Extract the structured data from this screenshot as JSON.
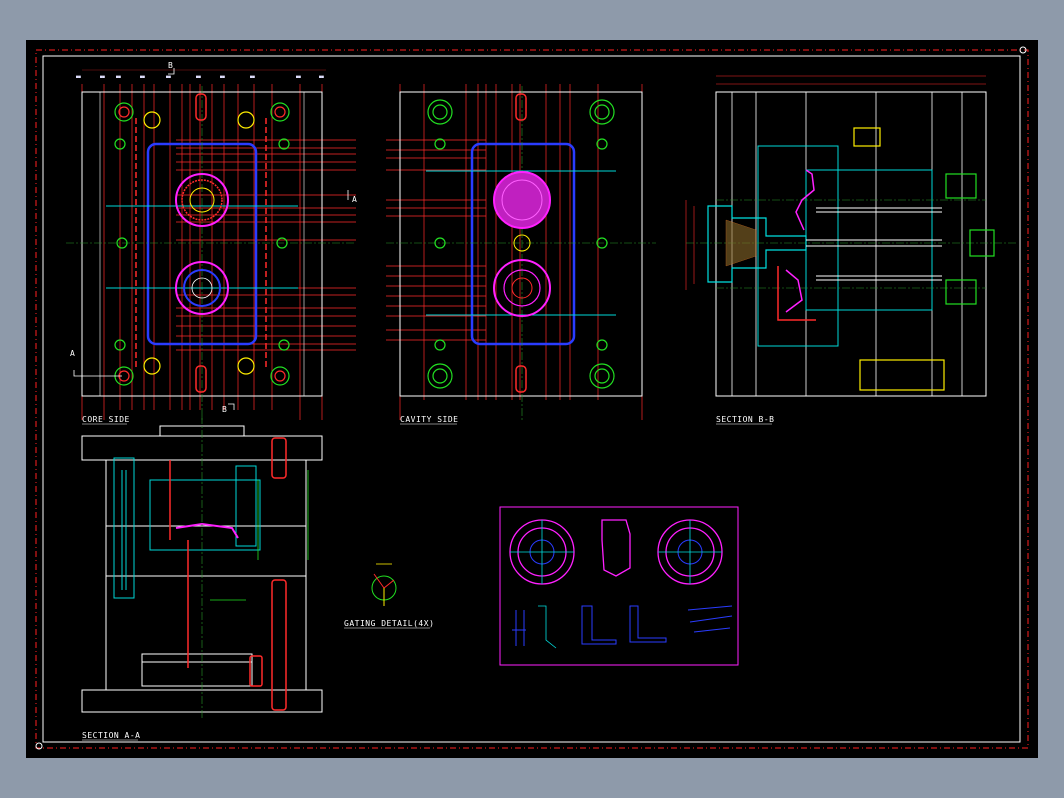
{
  "drawing": {
    "views": {
      "core_side": "CORE SIDE",
      "cavity_side": "CAVITY SIDE",
      "section_bb": "SECTION B-B",
      "section_aa": "SECTION A-A",
      "gating_detail": "GATING DETAIL(4X)"
    },
    "section_marks": {
      "a": "A",
      "b": "B"
    }
  },
  "colors": {
    "background": "#000000",
    "frame": "#ffffff",
    "border_dash": "#ff2020",
    "outline": "#ffffff",
    "dimension": "#ff2a2a",
    "centerline": "#2a9a2a",
    "insert": "#2a3cff",
    "cavity": "#ff20ff",
    "cyan": "#00e0e0",
    "green": "#22e022",
    "yellow": "#ffee00",
    "canvas": "#8e9aaa"
  }
}
